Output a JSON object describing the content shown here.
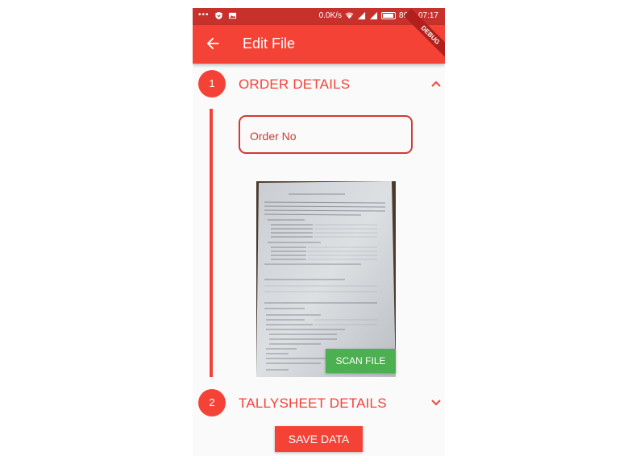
{
  "status_bar": {
    "notification_dots": "•••",
    "network_speed": "0.0K/s",
    "battery_percent": "86%",
    "time": "07:17"
  },
  "app_bar": {
    "title": "Edit File",
    "debug_banner": "DEBUG"
  },
  "steps": [
    {
      "number": "1",
      "title": "ORDER DETAILS",
      "expanded": true
    },
    {
      "number": "2",
      "title": "TALLYSHEET DETAILS",
      "expanded": false
    }
  ],
  "order_field": {
    "placeholder": "Order No",
    "value": ""
  },
  "scan_button": {
    "label": "SCAN FILE"
  },
  "save_button": {
    "label": "SAVE DATA"
  },
  "colors": {
    "primary": "#f44336",
    "status_bar": "#c8302c",
    "scan_button": "#4caf50"
  }
}
